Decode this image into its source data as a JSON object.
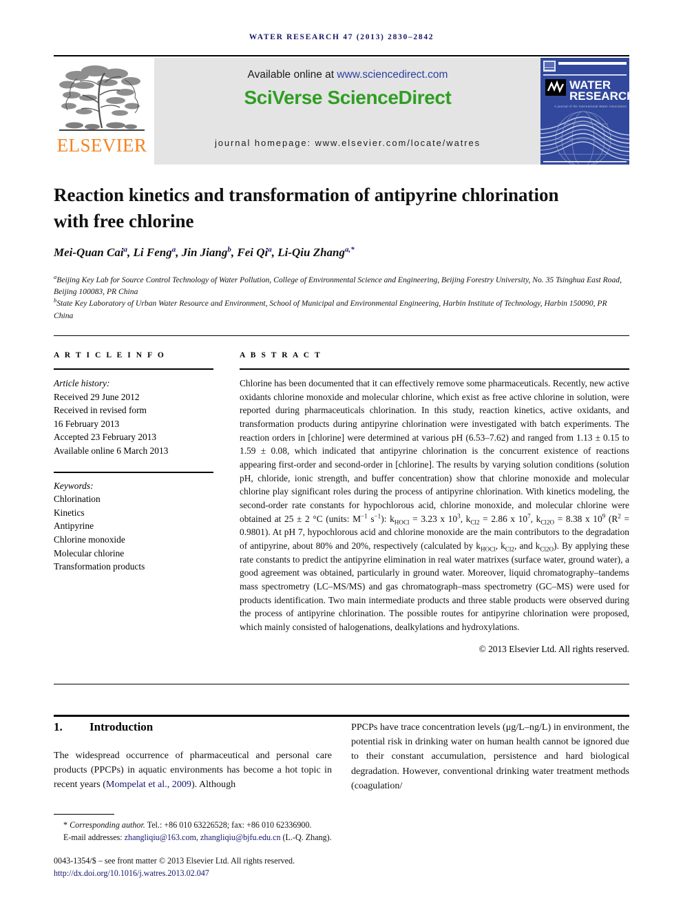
{
  "running_head": "WATER RESEARCH 47 (2013) 2830–2842",
  "masthead": {
    "publisher_wordmark": "ELSEVIER",
    "available_prefix": "Available online at ",
    "available_url": "www.sciencedirect.com",
    "platform_logo": "SciVerse ScienceDirect",
    "journal_homepage": "journal homepage: www.elsevier.com/locate/watres",
    "cover": {
      "society_mark": "IWA",
      "journal_title_line1": "WATER",
      "journal_title_line2": "RESEARCH",
      "tagline": "A journal of the International Water Association"
    },
    "colors": {
      "elsevier_orange": "#F58220",
      "sciencedirect_green": "#2f9e23",
      "link_blue": "#2a3fa0",
      "cover_blue": "#31489c",
      "banner_gray": "#e4e4e4"
    }
  },
  "article": {
    "title": "Reaction kinetics and transformation of antipyrine chlorination with free chlorine",
    "authors": [
      {
        "name": "Mei-Quan Cai",
        "marks": "a"
      },
      {
        "name": "Li Feng",
        "marks": "a"
      },
      {
        "name": "Jin Jiang",
        "marks": "b"
      },
      {
        "name": "Fei Qi",
        "marks": "a"
      },
      {
        "name": "Li-Qiu Zhang",
        "marks": "a,*"
      }
    ],
    "authors_line": "Mei-Quan Cai a, Li Feng a, Jin Jiang b, Fei Qi a, Li-Qiu Zhang a,*",
    "affiliations": [
      {
        "mark": "a",
        "text": "Beijing Key Lab for Source Control Technology of Water Pollution, College of Environmental Science and Engineering, Beijing Forestry University, No. 35 Tsinghua East Road, Beijing 100083, PR China"
      },
      {
        "mark": "b",
        "text": "State Key Laboratory of Urban Water Resource and Environment, School of Municipal and Environmental Engineering, Harbin Institute of Technology, Harbin 150090, PR China"
      }
    ]
  },
  "article_info": {
    "heading": "A R T I C L E  I N F O",
    "history_label": "Article history:",
    "history": [
      "Received 29 June 2012",
      "Received in revised form",
      "16 February 2013",
      "Accepted 23 February 2013",
      "Available online 6 March 2013"
    ],
    "keywords_label": "Keywords:",
    "keywords": [
      "Chlorination",
      "Kinetics",
      "Antipyrine",
      "Chlorine monoxide",
      "Molecular chlorine",
      "Transformation products"
    ]
  },
  "abstract": {
    "heading": "A B S T R A C T",
    "part1": "Chlorine has been documented that it can effectively remove some pharmaceuticals. Recently, new active oxidants chlorine monoxide and molecular chlorine, which exist as free active chlorine in solution, were reported during pharmaceuticals chlorination. In this study, reaction kinetics, active oxidants, and transformation products during antipyrine chlorination were investigated with batch experiments. The reaction orders in [chlorine] were determined at various pH (6.53–7.62) and ranged from 1.13 ± 0.15 to 1.59 ± 0.08, which indicated that antipyrine chlorination is the concurrent existence of reactions appearing first-order and second-order in [chlorine]. The results by varying solution conditions (solution pH, chloride, ionic strength, and buffer concentration) show that chlorine monoxide and molecular chlorine play significant roles during the process of antipyrine chlorination. With kinetics modeling, the second-order rate constants for hypochlorous acid, chlorine monoxide, and molecular chlorine were obtained at 25 ± 2 °C (units: M",
    "units_exp1": "−1",
    "units_mid": " s",
    "units_exp2": "−1",
    "units_close": "):",
    "k_hocl_label": "k",
    "k_hocl_sub": "HOCl",
    "k_hocl_value": " = 3.23 x 10",
    "k_hocl_exp": "3",
    "k_cl2_label": ", k",
    "k_cl2_sub": "Cl2",
    "k_cl2_value": " = 2.86 x 10",
    "k_cl2_exp": "7",
    "k_cl2o_label": ", k",
    "k_cl2o_sub": "Cl2O",
    "k_cl2o_value": " = 8.38 x 10",
    "k_cl2o_exp": "9",
    "r2_open": " (R",
    "r2_exp": "2",
    "r2_value": " = 0.9801). ",
    "part2": "At pH 7, hypochlorous acid and chlorine monoxide are the main contributors to the degradation of antipyrine, about 80% and 20%, respectively (calculated by k",
    "calc_sub1": "HOCl",
    "calc_mid1": ", k",
    "calc_sub2": "Cl2",
    "calc_mid2": ", and k",
    "calc_sub3": "Cl2O",
    "part3": "). By applying these rate constants to predict the antipyrine elimination in real water matrixes (surface water, ground water), a good agreement was obtained, particularly in ground water. Moreover, liquid chromatography–tandems mass spectrometry (LC–MS/MS) and gas chromatograph–mass spectrometry (GC–MS) were used for products identification. Two main intermediate products and three stable products were observed during the process of antipyrine chlorination. The possible routes for antipyrine chlorination were proposed, which mainly consisted of halogenations, dealkylations and hydroxylations.",
    "copyright": "© 2013 Elsevier Ltd. All rights reserved."
  },
  "body": {
    "section_number": "1.",
    "section_title": "Introduction",
    "left_paragraph_pre": "The widespread occurrence of pharmaceutical and personal care products (PPCPs) in aquatic environments has become a hot topic in recent years (",
    "left_citation": "Mompelat et al., 2009",
    "left_paragraph_post": "). Although",
    "right_paragraph": "PPCPs have trace concentration levels (μg/L–ng/L) in environment, the potential risk in drinking water on human health cannot be ignored due to their constant accumulation, persistence and hard biological degradation. However, conventional drinking water treatment methods (coagulation/"
  },
  "footer": {
    "corresponding_label": "Corresponding author.",
    "contact": " Tel.: +86 010 63226528; fax: +86 010 62336900.",
    "email_label": "E-mail addresses: ",
    "email1": "zhangliqiu@163.com",
    "email_sep": ", ",
    "email2": "zhangliqiu@bjfu.edu.cn",
    "email_attrib": " (L.-Q. Zhang).",
    "issn_line": "0043-1354/$ – see front matter © 2013 Elsevier Ltd. All rights reserved.",
    "doi": "http://dx.doi.org/10.1016/j.watres.2013.02.047"
  }
}
